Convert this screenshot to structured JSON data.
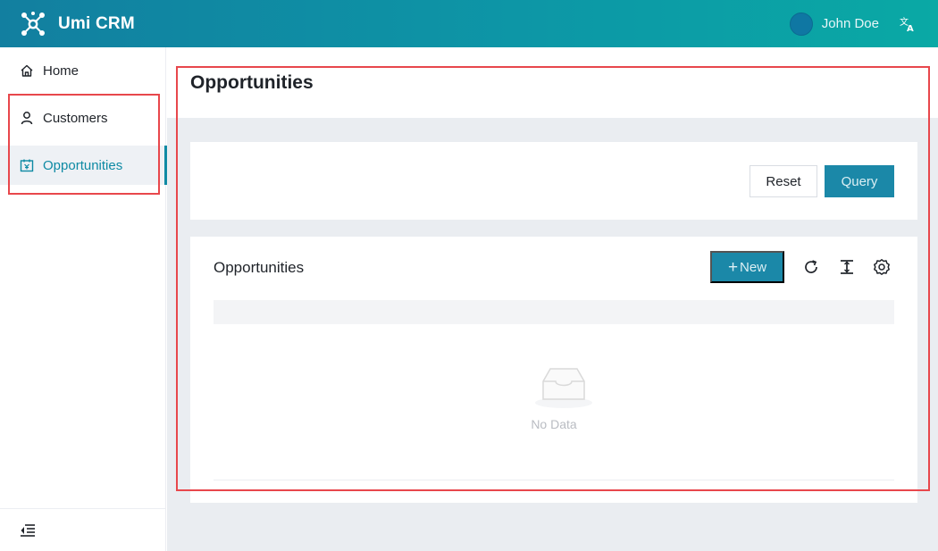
{
  "app": {
    "title": "Umi CRM"
  },
  "header": {
    "user_name": "John Doe",
    "language_icon": "translate-icon",
    "logo_icon": "molecule-logo-icon"
  },
  "sidebar": {
    "items": [
      {
        "label": "Home",
        "icon": "home-icon"
      },
      {
        "label": "Customers",
        "icon": "user-icon"
      },
      {
        "label": "Opportunities",
        "icon": "calendar-icon",
        "active": true
      }
    ],
    "collapse_icon": "menu-fold-icon"
  },
  "page": {
    "title": "Opportunities"
  },
  "search": {
    "reset_label": "Reset",
    "query_label": "Query"
  },
  "table": {
    "title": "Opportunities",
    "new_label": "New",
    "toolbar_icons": [
      "reload-icon",
      "column-height-icon",
      "settings-icon"
    ],
    "empty_text": "No Data"
  },
  "colors": {
    "accent": "#1b88a8",
    "header_start": "#127fa0",
    "header_end": "#0aa9a5",
    "highlight_box": "#e8474c"
  }
}
